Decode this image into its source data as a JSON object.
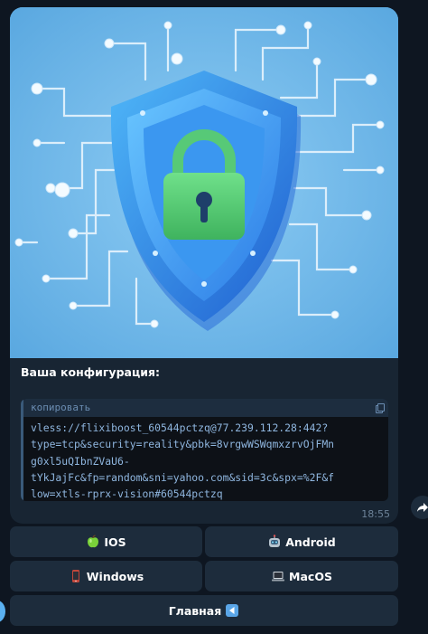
{
  "message": {
    "caption": "Ваша конфигурация:",
    "code_label": "копировать",
    "code_lines": [
      "vless://flixiboost_60544pctzq@77.239.112.28:442?",
      "type=tcp&security=reality&pbk=8vrgwWSWqmxzrvOjFMn",
      "g0xl5uQIbnZVaU6-",
      "tYkJajFc&fp=random&sni=yahoo.com&sid=3c&spx=%2F&f",
      "low=xtls-rprx-vision#60544pctzq"
    ],
    "time": "18:55"
  },
  "keyboard": {
    "ios": "IOS",
    "android": "Android",
    "windows": "Windows",
    "macos": "MacOS",
    "main": "Главная"
  },
  "icons": {
    "ios": "green-apple-icon",
    "android": "robot-icon",
    "windows": "mobile-phone-icon",
    "macos": "laptop-icon",
    "main": "back-arrow-icon",
    "copy": "copy-icon",
    "share": "share-icon",
    "hero": "shield-lock-image"
  },
  "colors": {
    "background": "#0e1621",
    "bubble": "#182533",
    "button": "#1d2c3c",
    "code_text": "#8fb6df"
  }
}
